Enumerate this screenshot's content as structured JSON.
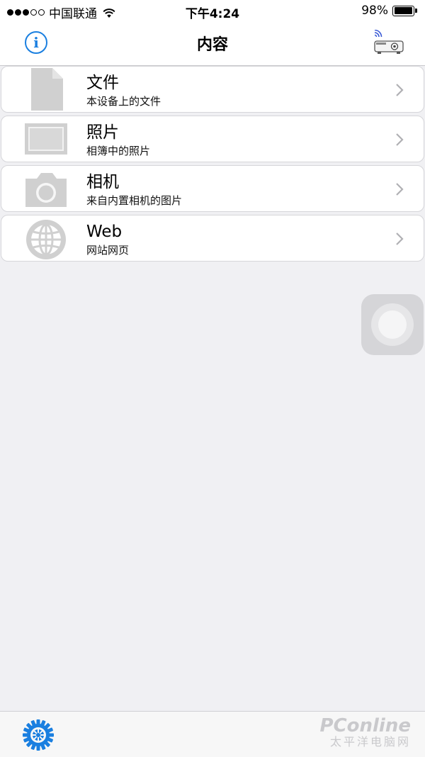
{
  "status_bar": {
    "carrier": "中国联通",
    "time": "下午4:24",
    "battery": "98%",
    "signal_filled": 3,
    "signal_total": 5
  },
  "nav": {
    "title": "内容",
    "left_icon": "info-icon",
    "left_glyph": "i",
    "right_icon": "projector-icon"
  },
  "items": [
    {
      "title": "文件",
      "subtitle": "本设备上的文件",
      "icon": "file-icon"
    },
    {
      "title": "照片",
      "subtitle": "相簿中的照片",
      "icon": "photo-icon"
    },
    {
      "title": "相机",
      "subtitle": "来自内置相机的图片",
      "icon": "camera-icon"
    },
    {
      "title": "Web",
      "subtitle": "网站网页",
      "icon": "globe-icon"
    }
  ],
  "toolbar": {
    "settings_icon": "gear-icon"
  },
  "watermark": {
    "main": "PConline",
    "sub": "太平洋电脑网"
  },
  "colors": {
    "accent": "#1a7fe0",
    "icon_gray": "#cfcfcf",
    "background": "#f0f0f3"
  }
}
